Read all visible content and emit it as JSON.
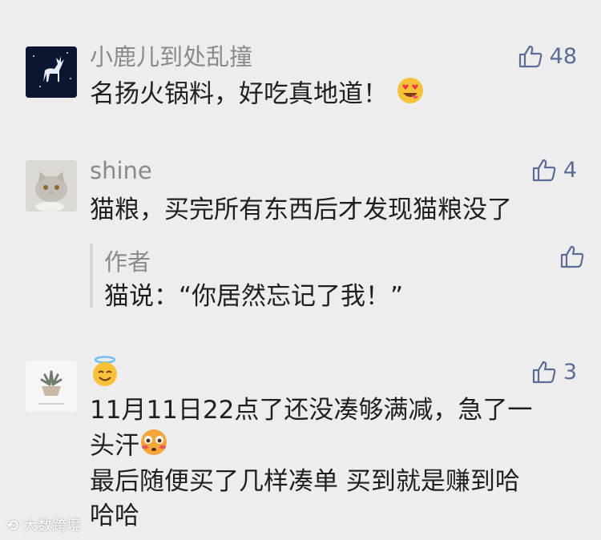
{
  "comments": [
    {
      "nickname": "小鹿儿到处乱撞",
      "likes": "48",
      "text": "名扬火锅料，好吃真地道！",
      "emoji": "heart-eyes"
    },
    {
      "nickname": "shine",
      "likes": "4",
      "text": "猫粮，买完所有东西后才发现猫粮没了",
      "reply": {
        "author": "作者",
        "text": "猫说：“你居然忘记了我！”"
      }
    },
    {
      "nickname_emoji": "halo-face",
      "likes": "3",
      "lines": [
        "11月11日22点了还没凑够满减，急了一",
        "头汗",
        "最后随便买了几样凑单  买到就是赚到哈",
        "哈哈"
      ]
    }
  ],
  "watermark": "大数跨境",
  "colors": {
    "background": "#ededed",
    "like": "#5b6d96",
    "nickname": "#8a8a8a",
    "text": "#1f1f1f"
  }
}
